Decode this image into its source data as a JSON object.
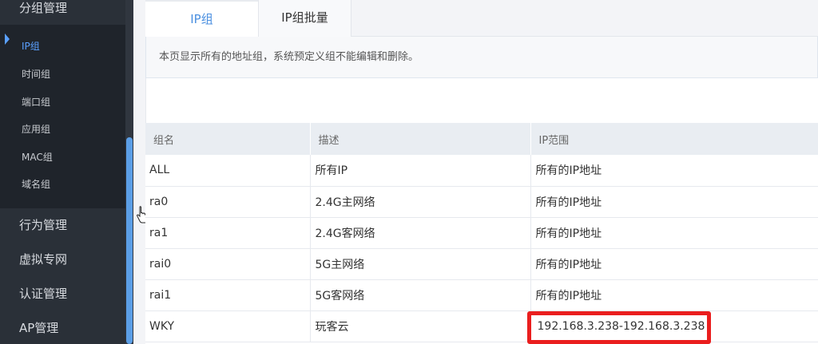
{
  "sidebar": {
    "group_top": "分组管理",
    "submenu": [
      {
        "label": "IP组",
        "active": true
      },
      {
        "label": "时间组",
        "active": false
      },
      {
        "label": "端口组",
        "active": false
      },
      {
        "label": "应用组",
        "active": false
      },
      {
        "label": "MAC组",
        "active": false
      },
      {
        "label": "域名组",
        "active": false
      }
    ],
    "groups": [
      "行为管理",
      "虚拟专网",
      "认证管理",
      "AP管理"
    ]
  },
  "tabs": [
    {
      "label": "IP组",
      "active": true
    },
    {
      "label": "IP组批量",
      "active": false
    }
  ],
  "notice": "本页显示所有的地址组，系统预定义组不能编辑和删除。",
  "table": {
    "columns": [
      "组名",
      "描述",
      "IP范围"
    ],
    "rows": [
      [
        "ALL",
        "所有IP",
        "所有的IP地址"
      ],
      [
        "ra0",
        "2.4G主网络",
        "所有的IP地址"
      ],
      [
        "ra1",
        "2.4G客网络",
        "所有的IP地址"
      ],
      [
        "rai0",
        "5G主网络",
        "所有的IP地址"
      ],
      [
        "rai1",
        "5G客网络",
        "所有的IP地址"
      ],
      [
        "WKY",
        "玩客云",
        "192.168.3.238-192.168.3.238"
      ]
    ]
  },
  "colors": {
    "accent": "#4a8fe0",
    "highlight": "#ea1e1e",
    "sidebar_bg": "#2a3038"
  }
}
